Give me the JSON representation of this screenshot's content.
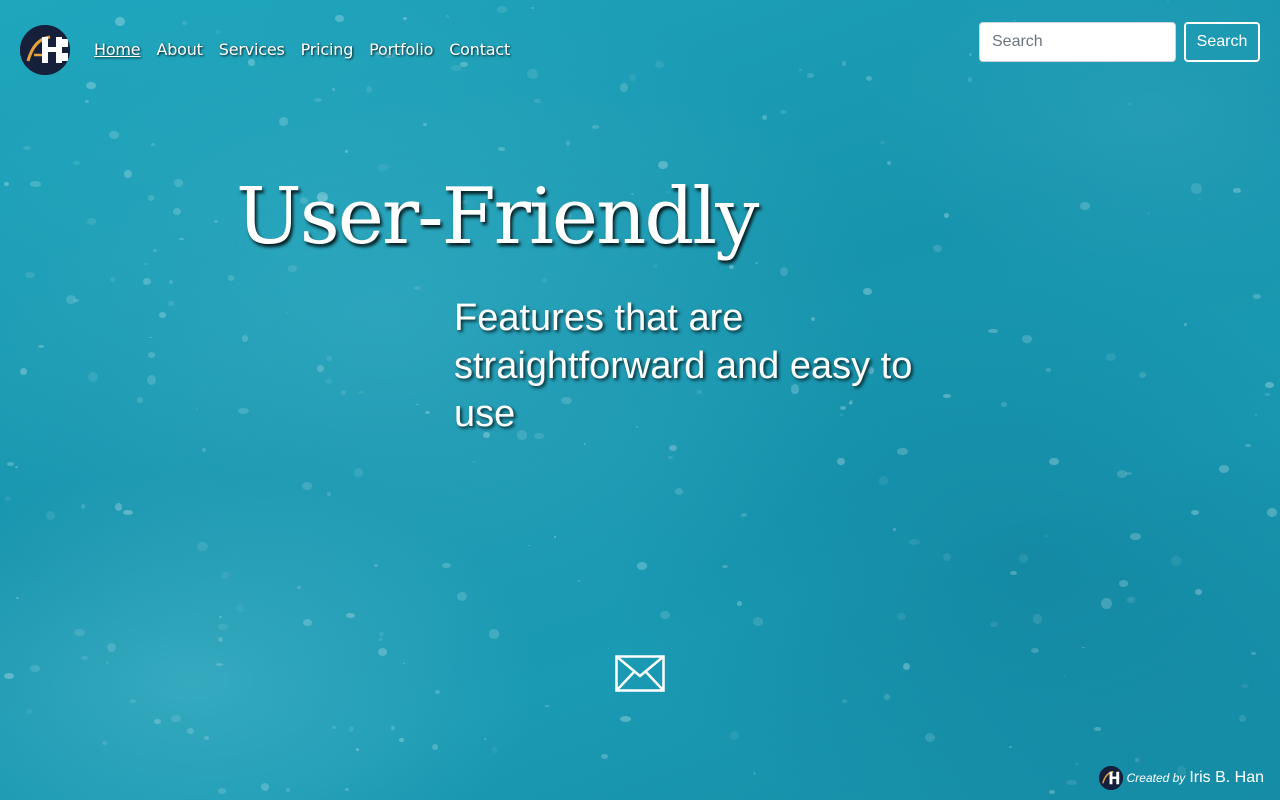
{
  "header": {
    "logo_icon": "ibh-monogram-logo",
    "nav": [
      {
        "label": "Home",
        "active": true
      },
      {
        "label": "About",
        "active": false
      },
      {
        "label": "Services",
        "active": false
      },
      {
        "label": "Pricing",
        "active": false
      },
      {
        "label": "Portfolio",
        "active": false
      },
      {
        "label": "Contact",
        "active": false
      }
    ],
    "search": {
      "placeholder": "Search",
      "value": "",
      "button_label": "Search"
    }
  },
  "hero": {
    "title": "User-Friendly",
    "subtitle": "Features that are straightforward and easy to use",
    "contact_icon": "envelope-icon"
  },
  "footer": {
    "credit_prefix": "Created by",
    "credit_name": "Iris B. Han"
  },
  "colors": {
    "background": "#1a9bb3",
    "text": "#ffffff",
    "logo_bg": "#16203a",
    "logo_accent": "#e8a33a"
  }
}
